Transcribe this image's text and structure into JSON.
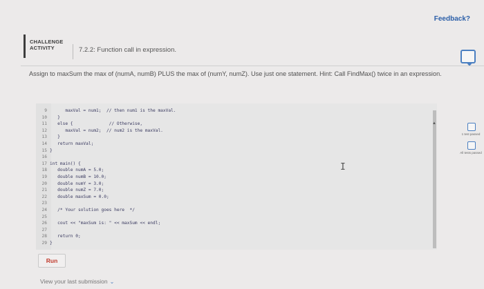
{
  "header": {
    "feedback": "Feedback?"
  },
  "activity": {
    "type_line1": "CHALLENGE",
    "type_line2": "ACTIVITY",
    "title": "7.2.2: Function call in expression."
  },
  "instructions": "Assign to maxSum the max of (numA, numB) PLUS the max of (numY, numZ). Use just one statement. Hint: Call FindMax() twice in an expression.",
  "code_lines": [
    {
      "n": "9",
      "text": "      maxVal = num1;  // then num1 is the maxVal."
    },
    {
      "n": "10",
      "text": "   }"
    },
    {
      "n": "11",
      "text": "   else {              // Otherwise,"
    },
    {
      "n": "12",
      "text": "      maxVal = num2;  // num2 is the maxVal."
    },
    {
      "n": "13",
      "text": "   }"
    },
    {
      "n": "14",
      "text": "   return maxVal;"
    },
    {
      "n": "15",
      "text": "}"
    },
    {
      "n": "16",
      "text": ""
    },
    {
      "n": "17",
      "text": "int main() {"
    },
    {
      "n": "18",
      "text": "   double numA = 5.0;"
    },
    {
      "n": "19",
      "text": "   double numB = 10.0;"
    },
    {
      "n": "20",
      "text": "   double numY = 3.0;"
    },
    {
      "n": "21",
      "text": "   double numZ = 7.0;"
    },
    {
      "n": "22",
      "text": "   double maxSum = 0.0;"
    },
    {
      "n": "23",
      "text": ""
    },
    {
      "n": "24",
      "text": "   /* Your solution goes here  */"
    },
    {
      "n": "25",
      "text": ""
    },
    {
      "n": "26",
      "text": "   cout << \"maxSum is: \" << maxSum << endl;"
    },
    {
      "n": "27",
      "text": ""
    },
    {
      "n": "28",
      "text": "   return 0;"
    },
    {
      "n": "29",
      "text": "}"
    }
  ],
  "side": {
    "test1": "1 test passed",
    "test2": "All tests passed"
  },
  "run_label": "Run",
  "last_submission": "View your last submission",
  "icons": {
    "dropdown": "chevron-down-icon",
    "feedback_bubble": "speech-bubble-icon",
    "cursor": "text-cursor-icon"
  },
  "colors": {
    "accent": "#4a7fc1",
    "run_text": "#c0392b"
  }
}
